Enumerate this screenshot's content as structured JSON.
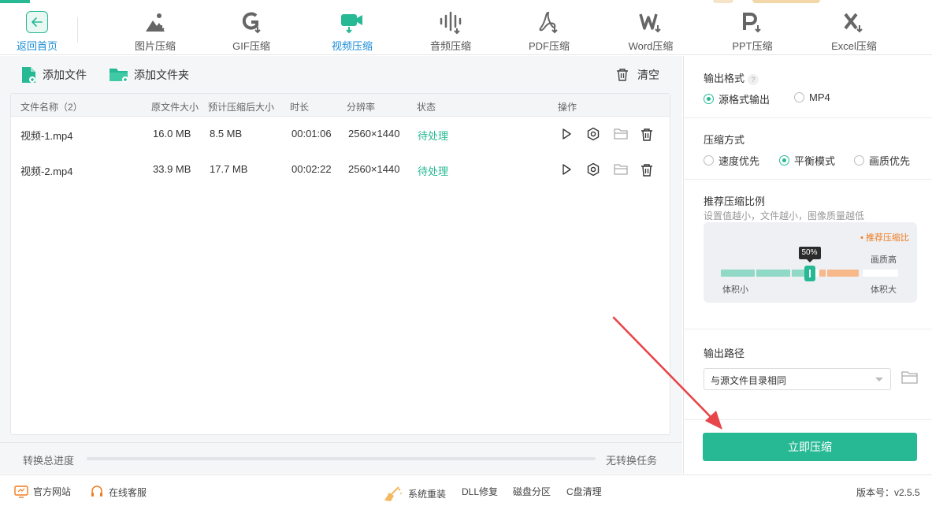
{
  "nav": {
    "home_label": "返回首页",
    "tabs": [
      {
        "id": "image",
        "label": "图片压缩",
        "icon": "image-compress-icon"
      },
      {
        "id": "gif",
        "label": "GIF压缩",
        "icon": "gif-compress-icon"
      },
      {
        "id": "video",
        "label": "视频压缩",
        "icon": "video-compress-icon",
        "active": true
      },
      {
        "id": "audio",
        "label": "音频压缩",
        "icon": "audio-compress-icon"
      },
      {
        "id": "pdf",
        "label": "PDF压缩",
        "icon": "pdf-compress-icon"
      },
      {
        "id": "word",
        "label": "Word压缩",
        "icon": "word-compress-icon"
      },
      {
        "id": "ppt",
        "label": "PPT压缩",
        "icon": "ppt-compress-icon"
      },
      {
        "id": "excel",
        "label": "Excel压缩",
        "icon": "excel-compress-icon"
      }
    ]
  },
  "toolbar": {
    "add_file": "添加文件",
    "add_folder": "添加文件夹",
    "clear": "清空"
  },
  "table": {
    "headers": {
      "name": "文件名称（2）",
      "orig_size": "原文件大小",
      "est_size": "预计压缩后大小",
      "duration": "时长",
      "resolution": "分辨率",
      "status": "状态",
      "actions": "操作"
    },
    "rows": [
      {
        "name": "视频-1.mp4",
        "orig_size": "16.0 MB",
        "est_size": "8.5 MB",
        "duration": "00:01:06",
        "resolution": "2560×1440",
        "status": "待处理"
      },
      {
        "name": "视频-2.mp4",
        "orig_size": "33.9 MB",
        "est_size": "17.7 MB",
        "duration": "00:02:22",
        "resolution": "2560×1440",
        "status": "待处理"
      }
    ]
  },
  "progress": {
    "label": "转换总进度",
    "value_fraction": 0,
    "status": "无转换任务"
  },
  "settings": {
    "output_format": {
      "title": "输出格式",
      "help": "?",
      "options": [
        "源格式输出",
        "MP4"
      ],
      "selected": 0
    },
    "compress_mode": {
      "title": "压缩方式",
      "options": [
        "速度优先",
        "平衡模式",
        "画质优先"
      ],
      "selected": 1
    },
    "ratio": {
      "title": "推荐压缩比例",
      "hint": "设置值越小，文件越小，图像质量越低",
      "recommended": "• 推荐压缩比",
      "value_label": "50%",
      "value_fraction": 0.5,
      "high_quality": "画质高",
      "small": "体积小",
      "large": "体积大"
    },
    "output_path": {
      "title": "输出路径",
      "value": "与源文件目录相同"
    },
    "start_button": "立即压缩"
  },
  "footer": {
    "website": "官方网站",
    "support": "在线客服",
    "reinstall": "系统重装",
    "dll": "DLL修复",
    "partition": "磁盘分区",
    "cclean": "C盘清理",
    "version": "版本号：v2.5.5"
  },
  "colors": {
    "accent": "#27b994",
    "link": "#1a8cd8",
    "orange": "#f07b1e",
    "arrow": "#e8454a"
  }
}
